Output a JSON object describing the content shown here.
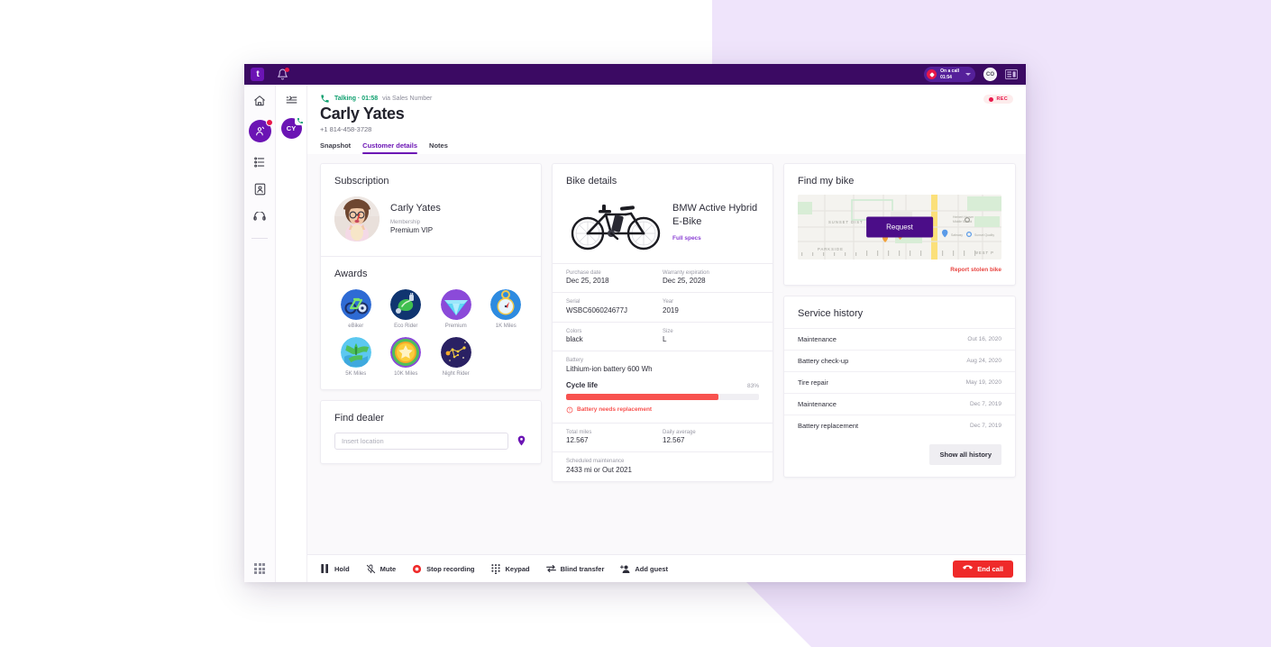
{
  "topbar": {
    "logo_text": "t",
    "logo_icon": "app-logo-icon",
    "bell_icon": "bell-icon",
    "call_status_label": "On a call",
    "call_status_time": "01:54",
    "user_initials": "CO",
    "panel_icon": "panel-layout-icon"
  },
  "rail": {
    "items": [
      {
        "icon": "home-icon",
        "name": "home"
      },
      {
        "icon": "agent-assist-icon",
        "name": "agent-assist",
        "active": true,
        "badge": true
      },
      {
        "icon": "queue-list-icon",
        "name": "queue"
      },
      {
        "icon": "contact-card-icon",
        "name": "contacts"
      },
      {
        "icon": "phone-icon",
        "name": "calls"
      }
    ],
    "apps_icon": "apps-grid-icon"
  },
  "contacts_column": {
    "collapse_icon": "collapse-list-icon",
    "active_contact_initials": "CY",
    "active_contact_status_icon": "phone-active-icon"
  },
  "call_header": {
    "phone_icon": "phone-talking-icon",
    "status": "Talking · 01:58",
    "via": "via Sales Number",
    "customer_name": "Carly Yates",
    "customer_phone": "+1 814-458-3728",
    "rec_label": "REC",
    "tabs": [
      {
        "label": "Snapshot",
        "active": false
      },
      {
        "label": "Customer details",
        "active": true
      },
      {
        "label": "Notes",
        "active": false
      }
    ]
  },
  "subscription": {
    "title": "Subscription",
    "avatar_icon": "customer-photo",
    "name": "Carly Yates",
    "membership_label": "Membership",
    "membership_value": "Premium VIP"
  },
  "awards": {
    "title": "Awards",
    "items": [
      {
        "label": "eBiker",
        "icon": "award-ebiker-icon"
      },
      {
        "label": "Eco Rider",
        "icon": "award-eco-rider-icon"
      },
      {
        "label": "Premium",
        "icon": "award-premium-icon"
      },
      {
        "label": "1K Miles",
        "icon": "award-1k-miles-icon"
      },
      {
        "label": "5K Miles",
        "icon": "award-5k-miles-icon"
      },
      {
        "label": "10K Miles",
        "icon": "award-10k-miles-icon"
      },
      {
        "label": "Night Rider",
        "icon": "award-night-rider-icon"
      }
    ]
  },
  "find_dealer": {
    "title": "Find dealer",
    "input_placeholder": "Insert location",
    "input_value": "",
    "pin_icon": "map-pin-icon"
  },
  "bike_details": {
    "title": "Bike details",
    "image_icon": "bicycle-image",
    "model": "BMW Active Hybrid E-Bike",
    "full_specs_link": "Full specs",
    "specs": [
      {
        "label": "Purchase date",
        "value": "Dec 25, 2018"
      },
      {
        "label": "Warranty expiration",
        "value": "Dec 25, 2028"
      },
      {
        "label": "Serial",
        "value": "WSBC606024677J"
      },
      {
        "label": "Year",
        "value": "2019"
      },
      {
        "label": "Colors",
        "value": "black"
      },
      {
        "label": "Size",
        "value": "L"
      }
    ],
    "battery_label": "Battery",
    "battery_value": "Lithium-ion battery 600 Wh",
    "cycle_life_label": "Cycle life",
    "cycle_life_percent": "83%",
    "cycle_life_fill": 79,
    "warning_icon": "warning-circle-icon",
    "warning_text": "Battery needs replacement",
    "mileage": [
      {
        "label": "Total miles",
        "value": "12.567"
      },
      {
        "label": "Daily average",
        "value": "12.567"
      }
    ],
    "scheduled_label": "Scheduled maintenance",
    "scheduled_value": "2433 mi or Out 2021"
  },
  "find_my_bike": {
    "title": "Find my bike",
    "map_icon": "map-view",
    "request_button": "Request",
    "report_link": "Report stolen bike"
  },
  "service_history": {
    "title": "Service history",
    "rows": [
      {
        "name": "Maintenance",
        "date": "Out 16, 2020"
      },
      {
        "name": "Battery check-up",
        "date": "Aug 24, 2020"
      },
      {
        "name": "Tire repair",
        "date": "May 19, 2020"
      },
      {
        "name": "Maintenance",
        "date": "Dec 7, 2019"
      },
      {
        "name": "Battery replacement",
        "date": "Dec 7, 2019"
      }
    ],
    "show_all_button": "Show all history"
  },
  "call_controls": {
    "items": [
      {
        "label": "Hold",
        "icon": "pause-icon"
      },
      {
        "label": "Mute",
        "icon": "microphone-muted-icon"
      },
      {
        "label": "Stop recording",
        "icon": "record-stop-icon"
      },
      {
        "label": "Keypad",
        "icon": "keypad-icon"
      },
      {
        "label": "Blind transfer",
        "icon": "transfer-arrows-icon"
      },
      {
        "label": "Add guest",
        "icon": "add-person-icon"
      }
    ],
    "end_call_label": "End call",
    "end_call_icon": "hangup-icon"
  },
  "colors": {
    "brand_purple": "#6B14B4",
    "topbar_purple": "#3B0A63",
    "accent_red": "#EF2A2A",
    "battery_red": "#F8524F",
    "talking_green": "#0E9F6E",
    "page_bg": "#EFE4FB"
  }
}
